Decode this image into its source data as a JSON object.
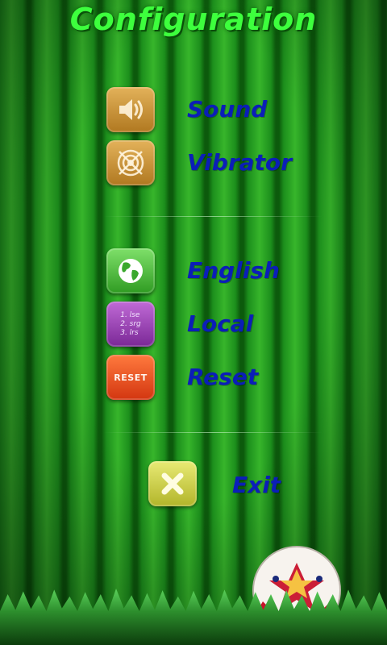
{
  "screen": {
    "title": "Configuration"
  },
  "audio": {
    "sound_label": "Sound",
    "vibrator_label": "Vibrator"
  },
  "language": {
    "english_label": "English",
    "local_label": "Local",
    "local_icon_lines": [
      "1. lse",
      "2. srg",
      "3. lrs"
    ],
    "reset_label": "Reset",
    "reset_icon_text": "RESET"
  },
  "footer": {
    "exit_label": "Exit"
  },
  "icons": {
    "sound": "speaker-icon",
    "vibrator": "vibration-icon",
    "english": "globe-icon",
    "local": "numbered-list-icon",
    "reset": "reset-icon",
    "exit": "close-x-icon",
    "ball": "soccer-ball-icon"
  },
  "colors": {
    "title": "#3dff3d",
    "label": "#0b1eb8",
    "sound_button": "#c48c33",
    "english_button": "#4fc43d",
    "local_button": "#9b43b8",
    "reset_button": "#e64a1c",
    "exit_button": "#cfd14a"
  }
}
